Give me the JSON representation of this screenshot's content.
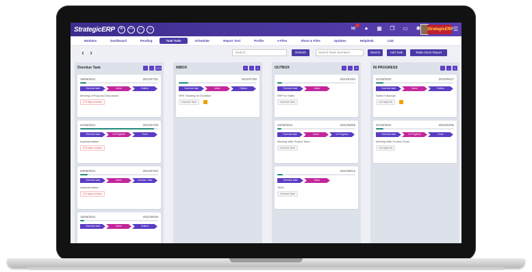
{
  "app": {
    "logo_text": "StrategicERP",
    "brand_badge": "StrategicERP",
    "nav_circles": [
      "≡",
      "⋯",
      "←",
      "→"
    ]
  },
  "colors": {
    "accent": "#4a3aa8",
    "topbar": "#3d2d8e",
    "chevron_purple": "#5b3cc4",
    "chevron_magenta": "#c2269b",
    "progress": "#1f8a7a"
  },
  "menu": {
    "items": [
      "Modules",
      "Dashboard",
      "Pending",
      "Task Todo",
      "Scheduler",
      "Report Tool",
      "Profile",
      "e-Files",
      "Share & Files",
      "Updates",
      "Helpdesk",
      "Link"
    ],
    "active_index": 3
  },
  "toolbar": {
    "prev": "‹",
    "next": "›",
    "search_placeholder": "Search...",
    "refresh_label": "Refresh",
    "search2_placeholder": "Search Team members",
    "search_btn": "Search",
    "add_task": "Add Task",
    "report_btn": "Tasks Done Report"
  },
  "columns": [
    {
      "title": "Overdue Task",
      "count": "272",
      "cards": [
        {
          "date1": "19/05/2021",
          "date2": "2021/07/31",
          "progress": 0.08,
          "stages": [
            "Overdue task",
            "Inbox",
            "Outbox"
          ],
          "desc": "Meeting of Proposal Discussion",
          "tag": "273 days overdue"
        },
        {
          "date1": "21/06/2021",
          "date2": "2021/07/28",
          "progress": 0.95,
          "stages": [
            "Overdue task",
            "In Progress",
            "Done"
          ],
          "desc": "Implementation",
          "tag": "275 days overdue"
        },
        {
          "date1": "03/05/2021",
          "date2": "2021/07/02",
          "progress": 0.1,
          "stages": [
            "Overdue task",
            "Inbox",
            "Overdue Task"
          ],
          "desc": "Implementation",
          "tag": "272 days overdue"
        },
        {
          "date1": "16/06/2021",
          "date2": "2021/06/26",
          "progress": 0.05,
          "stages": [
            "Overdue task",
            "Inbox",
            "Outbox"
          ],
          "desc": "",
          "tag": ""
        }
      ]
    },
    {
      "title": "INBOX",
      "count": "1",
      "cards": [
        {
          "date1": "",
          "date2": "2021/07/09",
          "progress": 0.12,
          "stages": [
            "Overdue task",
            "Inbox",
            "Outbox"
          ],
          "desc": "NPS Tracking for Donation",
          "tag": "Overdue Task"
        }
      ]
    },
    {
      "title": "OUTBOX",
      "count": "3",
      "cards": [
        {
          "date1": "",
          "date2": "2021/01/04",
          "progress": 0.06,
          "stages": [
            "Overdue task",
            "Inbox"
          ],
          "desc": "ERP for Sales",
          "tag": "Overdue Task"
        },
        {
          "date1": "22/06/2021",
          "date2": "2021/08/05",
          "progress": 0.05,
          "stages": [
            "Overdue task",
            "Inbox",
            "In Progress"
          ],
          "desc": "Meeting With Project Team",
          "tag": "Overdue Task"
        },
        {
          "date1": "",
          "date2": "2021/08/13",
          "progress": 0.07,
          "stages": [
            "Overdue task",
            "Inbox"
          ],
          "desc": "Test3",
          "tag": "Overdue Task"
        }
      ]
    },
    {
      "title": "IN PROGRESS",
      "count": "2",
      "cards": [
        {
          "date1": "21/03/2022",
          "date2": "2022/05/17",
          "progress": 0.1,
          "stages": [
            "Overdue task",
            "Inbox",
            "Outbox"
          ],
          "desc": "Sales Followups",
          "tag": "132 days left"
        },
        {
          "date1": "01/03/2022",
          "date2": "2022/03/05",
          "progress": 0.1,
          "stages": [
            "Overdue task",
            "In Progress",
            "Done"
          ],
          "desc": "Meeting With Product Team",
          "tag": "123 days left"
        }
      ]
    }
  ]
}
